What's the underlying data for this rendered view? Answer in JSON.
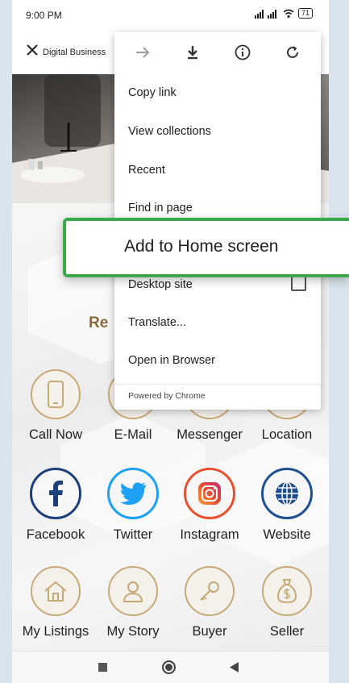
{
  "status": {
    "time": "9:00 PM",
    "battery": "71"
  },
  "browser": {
    "site_title": "Digital Business"
  },
  "section": {
    "title": "Re"
  },
  "grid": [
    {
      "label": "Call Now",
      "icon": "phone-icon"
    },
    {
      "label": "E-Mail",
      "icon": "email-icon"
    },
    {
      "label": "Messenger",
      "icon": "messenger-icon"
    },
    {
      "label": "Location",
      "icon": "location-icon"
    },
    {
      "label": "Facebook",
      "icon": "facebook-icon"
    },
    {
      "label": "Twitter",
      "icon": "twitter-icon"
    },
    {
      "label": "Instagram",
      "icon": "instagram-icon"
    },
    {
      "label": "Website",
      "icon": "globe-icon"
    },
    {
      "label": "My Listings",
      "icon": "home-icon"
    },
    {
      "label": "My Story",
      "icon": "person-icon"
    },
    {
      "label": "Buyer",
      "icon": "key-icon"
    },
    {
      "label": "Seller",
      "icon": "money-bag-icon"
    }
  ],
  "menu": {
    "items": [
      "Copy link",
      "View collections",
      "Recent",
      "Find in page",
      "Add to Home screen",
      "Desktop site",
      "Translate...",
      "Open in Browser"
    ],
    "footer": "Powered by Chrome",
    "highlighted_item": "Add to Home screen"
  },
  "colors": {
    "highlight_border": "#3aa84b",
    "gold_accent": "#c7a977",
    "facebook_blue": "#1d3f7a",
    "twitter_blue": "#1da1f2",
    "instagram_orange": "#e8502f",
    "website_blue": "#1f4f8f"
  }
}
